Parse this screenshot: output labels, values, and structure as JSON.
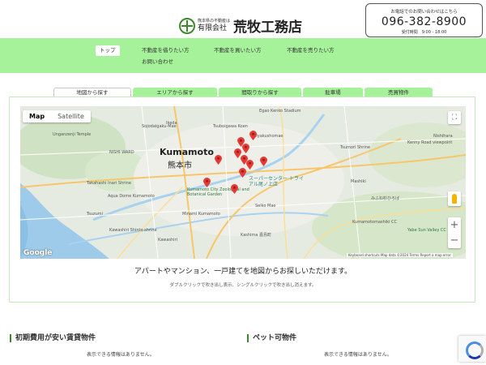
{
  "header": {
    "logo_sub": "熊本県の不動産は",
    "logo_company": "有限会社",
    "logo_name": "荒牧工務店",
    "contact_lead": "お電話でのお問い合わせはこちら",
    "phone": "096-382-8900",
    "hours": "受付時間　9:00 - 18:00"
  },
  "nav": {
    "items": [
      {
        "label": "トップ"
      },
      {
        "label": "不動産を借りたい方"
      },
      {
        "label": "不動産を買いたい方"
      },
      {
        "label": "不動産を売りたい方"
      },
      {
        "label": "お問い合わせ"
      }
    ]
  },
  "tabs": [
    {
      "label": "地図から探す"
    },
    {
      "label": "エリアから探す"
    },
    {
      "label": "間取りから探す"
    },
    {
      "label": "駐車場"
    },
    {
      "label": "売買物件"
    }
  ],
  "map": {
    "map_label": "Map",
    "satellite_label": "Satellite",
    "zoom_in": "+",
    "zoom_out": "−",
    "google": "Google",
    "footer": "Keyboard shortcuts   Map data ©2024   Terms   Report a map error",
    "places": {
      "kumamoto_en": "Kumamoto",
      "kumamoto_jp": "熊本市",
      "egao": "Egao Kenko Stadium",
      "tsuboigawa": "Tsuboigawa Koen",
      "sojodaigaku": "Sojodaigaku-Mae",
      "ikeda": "Ikeda",
      "shiyakusho": "Shiyakushomae",
      "nishi_ward": "NISHI WARD",
      "unganzenji": "Unganzenji Temple",
      "takahashi": "Takahashi Inari Shrine",
      "aqua": "Aqua Dome Kumamoto",
      "kumamoto_city_garden": "Kumamoto City Zoological and Botanical Garden",
      "minami_kumamoto": "Minami Kumamoto",
      "tsuzumi": "Tsuzumi",
      "supercenter": "スーパーセンター トライアル尾ノ上店",
      "kawashiri": "Kawashiri Shinto shrine",
      "kawashiri2": "Kawashiri",
      "kashima": "Kashima 嘉島町",
      "mashiki": "Mashiki",
      "tsumori": "Tsumori Shrine",
      "kenny": "Kenny Road viewpoint",
      "nishihara": "Nishihara",
      "yabe": "Yabe Sun Valley CC",
      "kumamotomashiki": "Kumamotomashiki CC",
      "mifune": "みふね杉ひろば",
      "seiko": "Seiko Mae"
    }
  },
  "map_caption": "アパートやマンション、一戸建てを地図からお探しいただけます。",
  "map_hint": "ダブルクリックで吹き出し表示、シングルクリックで吹き出し消えます。",
  "sections": [
    {
      "title": "初期費用が安い賃貸物件",
      "empty": "表示できる情報はありません。"
    },
    {
      "title": "ペット可物件",
      "empty": "表示できる情報はありません。"
    }
  ],
  "colors": {
    "nav_bg": "#a6f29a",
    "accent": "#3a8a2a",
    "pin": "#e53935"
  }
}
